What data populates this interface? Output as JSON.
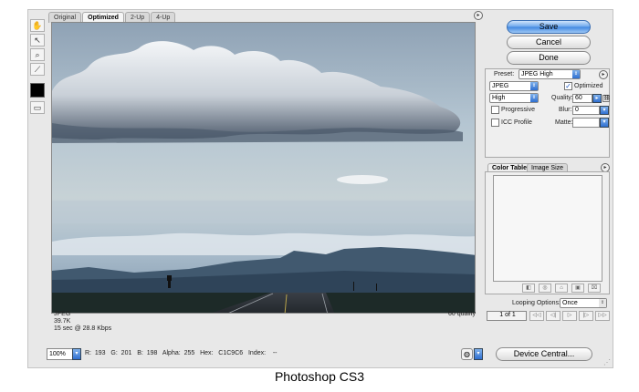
{
  "tabs": [
    "Original",
    "Optimized",
    "2-Up",
    "4-Up"
  ],
  "tools": {
    "hand": "hand-icon",
    "slice_select": "slice-select-icon",
    "zoom": "zoom-icon",
    "eyedropper": "eyedropper-icon",
    "toggle_slices": "toggle-slices-icon"
  },
  "image_info": {
    "format": "JPEG",
    "size": "39.7K",
    "time": "15 sec @ 28.8 Kbps",
    "quality": "60 quality"
  },
  "status": {
    "zoom": "100%",
    "readout": "R:  193   G:  201   B:  198   Alpha:  255   Hex:   C1C9C6   Index:    --"
  },
  "buttons": {
    "save": "Save",
    "cancel": "Cancel",
    "done": "Done",
    "device_central": "Device Central..."
  },
  "settings": {
    "preset_label": "Preset:",
    "preset_value": "JPEG High",
    "format_value": "JPEG",
    "optimized_label": "Optimized",
    "optimized_checked": true,
    "compression_value": "High",
    "quality_label": "Quality:",
    "quality_value": "60",
    "progressive_label": "Progressive",
    "blur_label": "Blur:",
    "blur_value": "0",
    "icc_label": "ICC Profile",
    "matte_label": "Matte:"
  },
  "color_panel": {
    "tabs": [
      "Color Table",
      "Image Size"
    ],
    "looping_label": "Looping Options:",
    "looping_value": "Once",
    "frame_counter": "1 of 1"
  },
  "caption": "Photoshop CS3",
  "colors": {
    "accent": "#3f86e0",
    "panel_bg": "#e8e8e8"
  }
}
